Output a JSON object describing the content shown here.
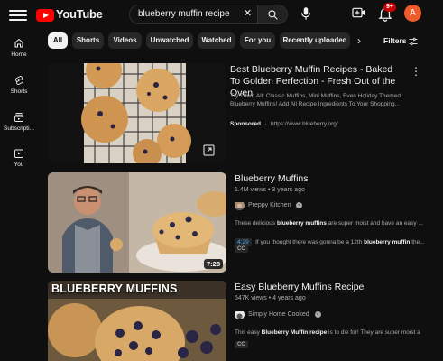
{
  "header": {
    "logo_text": "YouTube",
    "search_value": "blueberry muffin recipe",
    "notification_count": "9+",
    "avatar_letter": "A"
  },
  "guide": [
    {
      "label": "Home",
      "icon": "home-icon"
    },
    {
      "label": "Shorts",
      "icon": "shorts-icon"
    },
    {
      "label": "Subscripti...",
      "icon": "subscriptions-icon"
    },
    {
      "label": "You",
      "icon": "you-icon"
    }
  ],
  "chips": [
    "All",
    "Shorts",
    "Videos",
    "Unwatched",
    "Watched",
    "For you",
    "Recently uploaded"
  ],
  "filters_label": "Filters",
  "ad": {
    "title": "Best Blueberry Muffin Recipes - Baked To Golden Perfection - Fresh Out of the Oven",
    "description": "Try Them All: Classic Muffins, Mini Muffins, Even Holiday Themed Blueberry Muffins! Add All Recipe Ingredients To Your Shopping...",
    "sponsored_label": "Sponsored",
    "separator": "·",
    "url": "https://www.blueberry.org/"
  },
  "results": [
    {
      "title": "Blueberry Muffins",
      "meta": "1.4M views • 3 years ago",
      "channel": "Preppy Kitchen",
      "duration": "7:28",
      "desc_prefix": "These delicious ",
      "desc_bold": "blueberry muffins",
      "desc_suffix": " are super moist and have an easy ...",
      "chapter_time": "4:29",
      "chapter_prefix": "If you thought there was gonna be a 12th ",
      "chapter_bold": "blueberry muffin",
      "chapter_suffix": " the...",
      "badge": "CC"
    },
    {
      "title": "Easy Blueberry Muffins Recipe",
      "meta": "547K views • 4 years ago",
      "channel": "Simply Home Cooked",
      "thumb_text": "BLUEBERRY MUFFINS",
      "desc_prefix": "This easy ",
      "desc_bold": "Blueberry Muffin recipe",
      "desc_suffix": " is to die for! They are super moist a",
      "badge": "CC"
    }
  ],
  "colors": {
    "background": "#0f0f0f",
    "brand_red": "#ff0000",
    "chip": "#272727",
    "link_blue": "#3ea6ff",
    "avatar": "#ef5b2b"
  }
}
